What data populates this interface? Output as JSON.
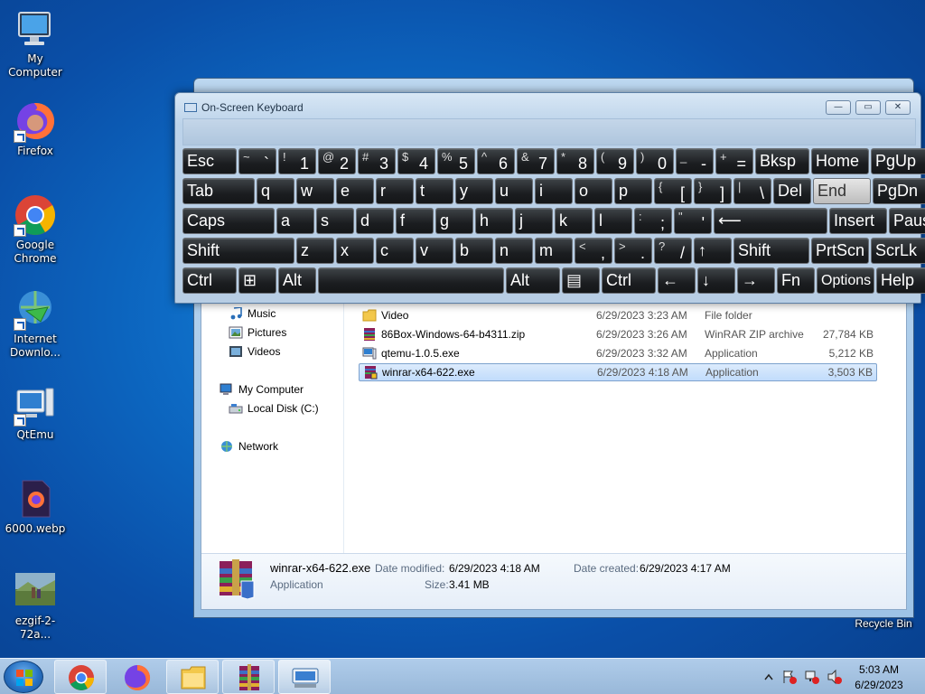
{
  "desktop": {
    "icons": [
      {
        "label": "My Computer"
      },
      {
        "label": "Firefox"
      },
      {
        "label": "Google Chrome"
      },
      {
        "label": "Internet Downlo..."
      },
      {
        "label": "QtEmu"
      },
      {
        "label": "6000.webp"
      },
      {
        "label": "ezgif-2-72a..."
      }
    ],
    "recycle_bin": "Recycle Bin"
  },
  "osk": {
    "title": "On-Screen Keyboard",
    "rows": [
      [
        {
          "label": "Esc"
        },
        {
          "shift": "~",
          "main": "`"
        },
        {
          "shift": "!",
          "main": "1"
        },
        {
          "shift": "@",
          "main": "2"
        },
        {
          "shift": "#",
          "main": "3"
        },
        {
          "shift": "$",
          "main": "4"
        },
        {
          "shift": "%",
          "main": "5"
        },
        {
          "shift": "^",
          "main": "6"
        },
        {
          "shift": "&",
          "main": "7"
        },
        {
          "shift": "*",
          "main": "8"
        },
        {
          "shift": "(",
          "main": "9"
        },
        {
          "shift": ")",
          "main": "0"
        },
        {
          "shift": "_",
          "main": "-"
        },
        {
          "shift": "+",
          "main": "="
        },
        {
          "label": "Bksp"
        },
        {
          "label": "Home"
        },
        {
          "label": "PgUp"
        }
      ],
      [
        {
          "label": "Tab"
        },
        {
          "label": "q"
        },
        {
          "label": "w"
        },
        {
          "label": "e"
        },
        {
          "label": "r"
        },
        {
          "label": "t"
        },
        {
          "label": "y"
        },
        {
          "label": "u"
        },
        {
          "label": "i"
        },
        {
          "label": "o"
        },
        {
          "label": "p"
        },
        {
          "shift": "{",
          "main": "["
        },
        {
          "shift": "}",
          "main": "]"
        },
        {
          "shift": "|",
          "main": "\\"
        },
        {
          "label": "Del"
        },
        {
          "label": "End"
        },
        {
          "label": "PgDn"
        }
      ],
      [
        {
          "label": "Caps"
        },
        {
          "label": "a"
        },
        {
          "label": "s"
        },
        {
          "label": "d"
        },
        {
          "label": "f"
        },
        {
          "label": "g"
        },
        {
          "label": "h"
        },
        {
          "label": "j"
        },
        {
          "label": "k"
        },
        {
          "label": "l"
        },
        {
          "shift": ":",
          "main": ";"
        },
        {
          "shift": "\"",
          "main": "'"
        },
        {
          "label": "⟵"
        },
        {
          "label": "Insert"
        },
        {
          "label": "Pause"
        }
      ],
      [
        {
          "label": "Shift"
        },
        {
          "label": "z"
        },
        {
          "label": "x"
        },
        {
          "label": "c"
        },
        {
          "label": "v"
        },
        {
          "label": "b"
        },
        {
          "label": "n"
        },
        {
          "label": "m"
        },
        {
          "shift": "<",
          "main": ","
        },
        {
          "shift": ">",
          "main": "."
        },
        {
          "shift": "?",
          "main": "/"
        },
        {
          "label": "↑"
        },
        {
          "label": "Shift"
        },
        {
          "label": "PrtScn"
        },
        {
          "label": "ScrLk"
        }
      ],
      [
        {
          "label": "Ctrl"
        },
        {
          "label": "⊞"
        },
        {
          "label": "Alt"
        },
        {
          "label": ""
        },
        {
          "label": "Alt"
        },
        {
          "label": "▤"
        },
        {
          "label": "Ctrl"
        },
        {
          "label": "←"
        },
        {
          "label": "↓"
        },
        {
          "label": "→"
        },
        {
          "label": "Fn"
        },
        {
          "label": "Options"
        },
        {
          "label": "Help"
        }
      ]
    ]
  },
  "explorer": {
    "nav": [
      {
        "label": "Music",
        "icon": "music-icon"
      },
      {
        "label": "Pictures",
        "icon": "pictures-icon"
      },
      {
        "label": "Videos",
        "icon": "videos-icon"
      },
      {
        "label": "My Computer",
        "icon": "computer-icon"
      },
      {
        "label": "Local Disk (C:)",
        "icon": "disk-icon"
      },
      {
        "label": "Network",
        "icon": "network-icon"
      }
    ],
    "files": [
      {
        "name": "Video",
        "date": "6/29/2023 3:23 AM",
        "type": "File folder",
        "size": "",
        "icon": "folder-icon"
      },
      {
        "name": "86Box-Windows-64-b4311.zip",
        "date": "6/29/2023 3:26 AM",
        "type": "WinRAR ZIP archive",
        "size": "27,784 KB",
        "icon": "winrar-archive-icon"
      },
      {
        "name": "qtemu-1.0.5.exe",
        "date": "6/29/2023 3:32 AM",
        "type": "Application",
        "size": "5,212 KB",
        "icon": "application-icon"
      },
      {
        "name": "winrar-x64-622.exe",
        "date": "6/29/2023 4:18 AM",
        "type": "Application",
        "size": "3,503 KB",
        "icon": "winrar-installer-icon"
      }
    ],
    "details": {
      "name": "winrar-x64-622.exe",
      "type": "Application",
      "modified_label": "Date modified:",
      "modified": "6/29/2023 4:18 AM",
      "created_label": "Date created:",
      "created": "6/29/2023 4:17 AM",
      "size_label": "Size:",
      "size": "3.41 MB"
    }
  },
  "taskbar": {
    "time": "5:03 AM",
    "date": "6/29/2023"
  },
  "colors": {
    "desktop_bg": "#0d6ac4",
    "key_bg": "#1b1d20",
    "selection": "#c1dcfc"
  }
}
